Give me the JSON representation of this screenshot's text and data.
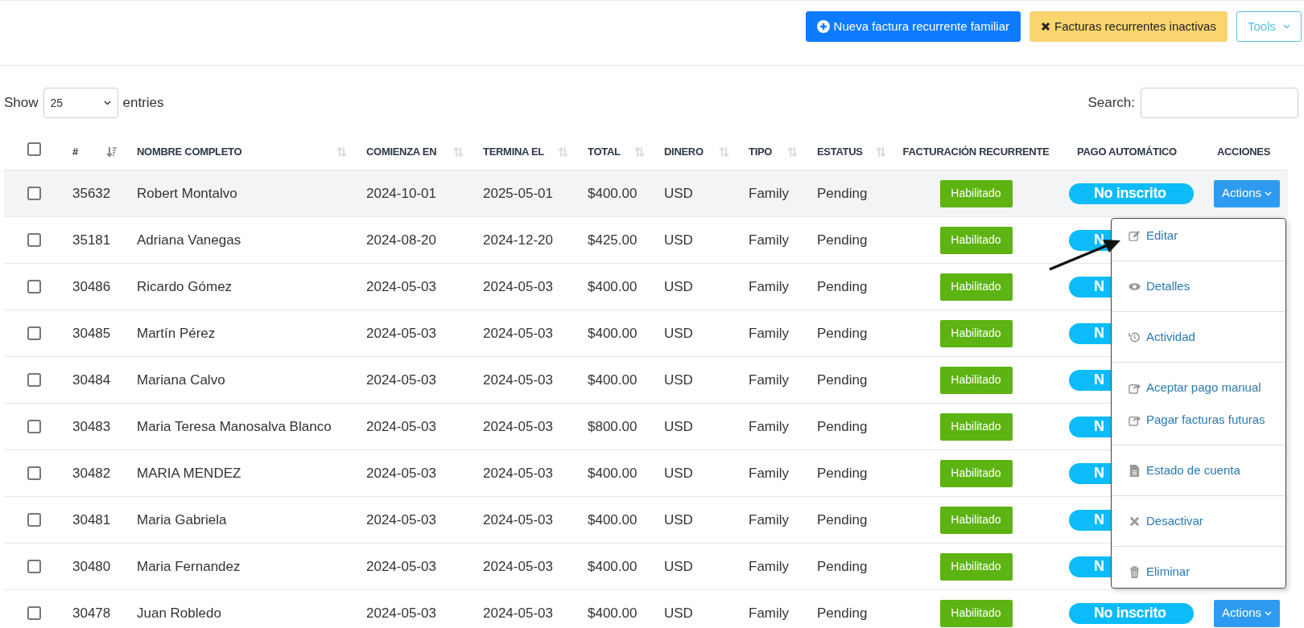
{
  "toolbar": {
    "buttons": [
      {
        "kind": "primary",
        "label": "Nueva factura recurrente familiar"
      },
      {
        "kind": "warning",
        "label": "Facturas recurrentes inactivas"
      },
      {
        "kind": "outline",
        "label": "Tools"
      }
    ]
  },
  "length_control": {
    "before": "Show",
    "value": "25",
    "after": "entries"
  },
  "search": {
    "label": "Search:"
  },
  "table": {
    "select_all": {
      "checked": false
    },
    "columns": [
      {
        "label": "#",
        "sortable": true,
        "sorted": true
      },
      {
        "label": "NOMBRE COMPLETO",
        "sortable": true,
        "sorted": false
      },
      {
        "label": "COMIENZA EN",
        "sortable": true,
        "sorted": false
      },
      {
        "label": "TERMINA EL",
        "sortable": true,
        "sorted": false
      },
      {
        "label": "TOTAL",
        "sortable": true,
        "sorted": false
      },
      {
        "label": "DINERO",
        "sortable": true,
        "sorted": false
      },
      {
        "label": "TIPO",
        "sortable": true,
        "sorted": false
      },
      {
        "label": "ESTATUS",
        "sortable": true,
        "sorted": false
      },
      {
        "label": "FACTURACIÓN RECURRENTE",
        "sortable": false
      },
      {
        "label": "PAGO AUTOMÁTICO",
        "sortable": false
      },
      {
        "label": "ACCIONES",
        "sortable": false
      }
    ],
    "rows": [
      {
        "checked": false,
        "highlighted": true,
        "id": "35632",
        "name": "Robert Montalvo",
        "start": "2024-10-01",
        "end": "2025-05-01",
        "total": "$400.00",
        "currency": "USD",
        "type": "Family",
        "status": "Pending",
        "recurring": "Habilitado",
        "autopay": "No inscrito",
        "actions": "Actions"
      },
      {
        "checked": false,
        "highlighted": false,
        "id": "35181",
        "name": "Adriana Vanegas",
        "start": "2024-08-20",
        "end": "2024-12-20",
        "total": "$425.00",
        "currency": "USD",
        "type": "Family",
        "status": "Pending",
        "recurring": "Habilitado",
        "autopay": "N"
      },
      {
        "checked": false,
        "highlighted": false,
        "id": "30486",
        "name": "Ricardo Gómez",
        "start": "2024-05-03",
        "end": "2024-05-03",
        "total": "$400.00",
        "currency": "USD",
        "type": "Family",
        "status": "Pending",
        "recurring": "Habilitado",
        "autopay": "N"
      },
      {
        "checked": false,
        "highlighted": false,
        "id": "30485",
        "name": "Martín Pérez",
        "start": "2024-05-03",
        "end": "2024-05-03",
        "total": "$400.00",
        "currency": "USD",
        "type": "Family",
        "status": "Pending",
        "recurring": "Habilitado",
        "autopay": "N"
      },
      {
        "checked": false,
        "highlighted": false,
        "id": "30484",
        "name": "Mariana Calvo",
        "start": "2024-05-03",
        "end": "2024-05-03",
        "total": "$400.00",
        "currency": "USD",
        "type": "Family",
        "status": "Pending",
        "recurring": "Habilitado",
        "autopay": "N"
      },
      {
        "checked": false,
        "highlighted": false,
        "id": "30483",
        "name": "Maria Teresa Manosalva Blanco",
        "start": "2024-05-03",
        "end": "2024-05-03",
        "total": "$800.00",
        "currency": "USD",
        "type": "Family",
        "status": "Pending",
        "recurring": "Habilitado",
        "autopay": "N"
      },
      {
        "checked": false,
        "highlighted": false,
        "id": "30482",
        "name": "MARIA MENDEZ",
        "start": "2024-05-03",
        "end": "2024-05-03",
        "total": "$400.00",
        "currency": "USD",
        "type": "Family",
        "status": "Pending",
        "recurring": "Habilitado",
        "autopay": "N"
      },
      {
        "checked": false,
        "highlighted": false,
        "id": "30481",
        "name": "Maria Gabriela",
        "start": "2024-05-03",
        "end": "2024-05-03",
        "total": "$400.00",
        "currency": "USD",
        "type": "Family",
        "status": "Pending",
        "recurring": "Habilitado",
        "autopay": "N"
      },
      {
        "checked": false,
        "highlighted": false,
        "id": "30480",
        "name": "Maria Fernandez",
        "start": "2024-05-03",
        "end": "2024-05-03",
        "total": "$400.00",
        "currency": "USD",
        "type": "Family",
        "status": "Pending",
        "recurring": "Habilitado",
        "autopay": "N"
      },
      {
        "checked": false,
        "highlighted": false,
        "id": "30478",
        "name": "Juan Robledo",
        "start": "2024-05-03",
        "end": "2024-05-03",
        "total": "$400.00",
        "currency": "USD",
        "type": "Family",
        "status": "Pending",
        "recurring": "Habilitado",
        "autopay": "No inscrito",
        "actions": "Actions"
      }
    ]
  },
  "actions_menu": {
    "sections": [
      [
        {
          "label": "Editar"
        }
      ],
      [
        {
          "label": "Detalles"
        }
      ],
      [
        {
          "label": "Actividad"
        }
      ],
      [
        {
          "label": "Aceptar pago manual"
        },
        {
          "label": "Pagar facturas futuras"
        }
      ],
      [
        {
          "label": "Estado de cuenta"
        }
      ],
      [
        {
          "label": "Desactivar"
        }
      ],
      [
        {
          "label": "Eliminar"
        }
      ]
    ]
  }
}
